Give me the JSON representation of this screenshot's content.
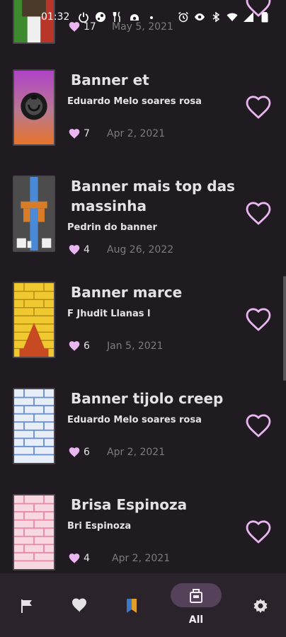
{
  "status_bar": {
    "time": "01:32",
    "icons_left": [
      "power-icon",
      "steam-icon",
      "restaurant-icon",
      "cloud-icon",
      "dot-icon"
    ],
    "icons_right": [
      "alarm-icon",
      "eye-icon",
      "bluetooth-icon",
      "wifi-icon",
      "signal-icon",
      "battery-icon"
    ]
  },
  "colors": {
    "background": "#1f1b20",
    "heart_accent": "#e9b6f0",
    "nav_background": "#2b232c",
    "nav_active_pill": "#55415a",
    "date_text": "#7e7a80"
  },
  "banners": [
    {
      "title": "",
      "author": "",
      "likes": "17",
      "date": "May 5, 2021"
    },
    {
      "title": "Banner et",
      "author": "Eduardo Melo soares rosa",
      "likes": "7",
      "date": "Apr 2, 2021"
    },
    {
      "title": "Banner mais top das massinha",
      "author": "Pedrin do banner",
      "likes": "4",
      "date": "Aug 26, 2022"
    },
    {
      "title": "Banner marce",
      "author": "F Jhudit Llanas l",
      "likes": "6",
      "date": "Jan 5, 2021"
    },
    {
      "title": "Banner tijolo creep",
      "author": "Eduardo Melo soares rosa",
      "likes": "6",
      "date": "Apr 2, 2021"
    },
    {
      "title": "Brisa Espinoza",
      "author": "Bri Espinoza",
      "likes": "4",
      "date": "Apr 2, 2021"
    }
  ],
  "bottom_nav": {
    "items": [
      {
        "icon": "flag-icon",
        "label": ""
      },
      {
        "icon": "heart-icon",
        "label": ""
      },
      {
        "icon": "bookmark-icon",
        "label": ""
      },
      {
        "icon": "all-banners-icon",
        "label": "All",
        "active": true
      },
      {
        "icon": "gear-icon",
        "label": ""
      }
    ]
  }
}
